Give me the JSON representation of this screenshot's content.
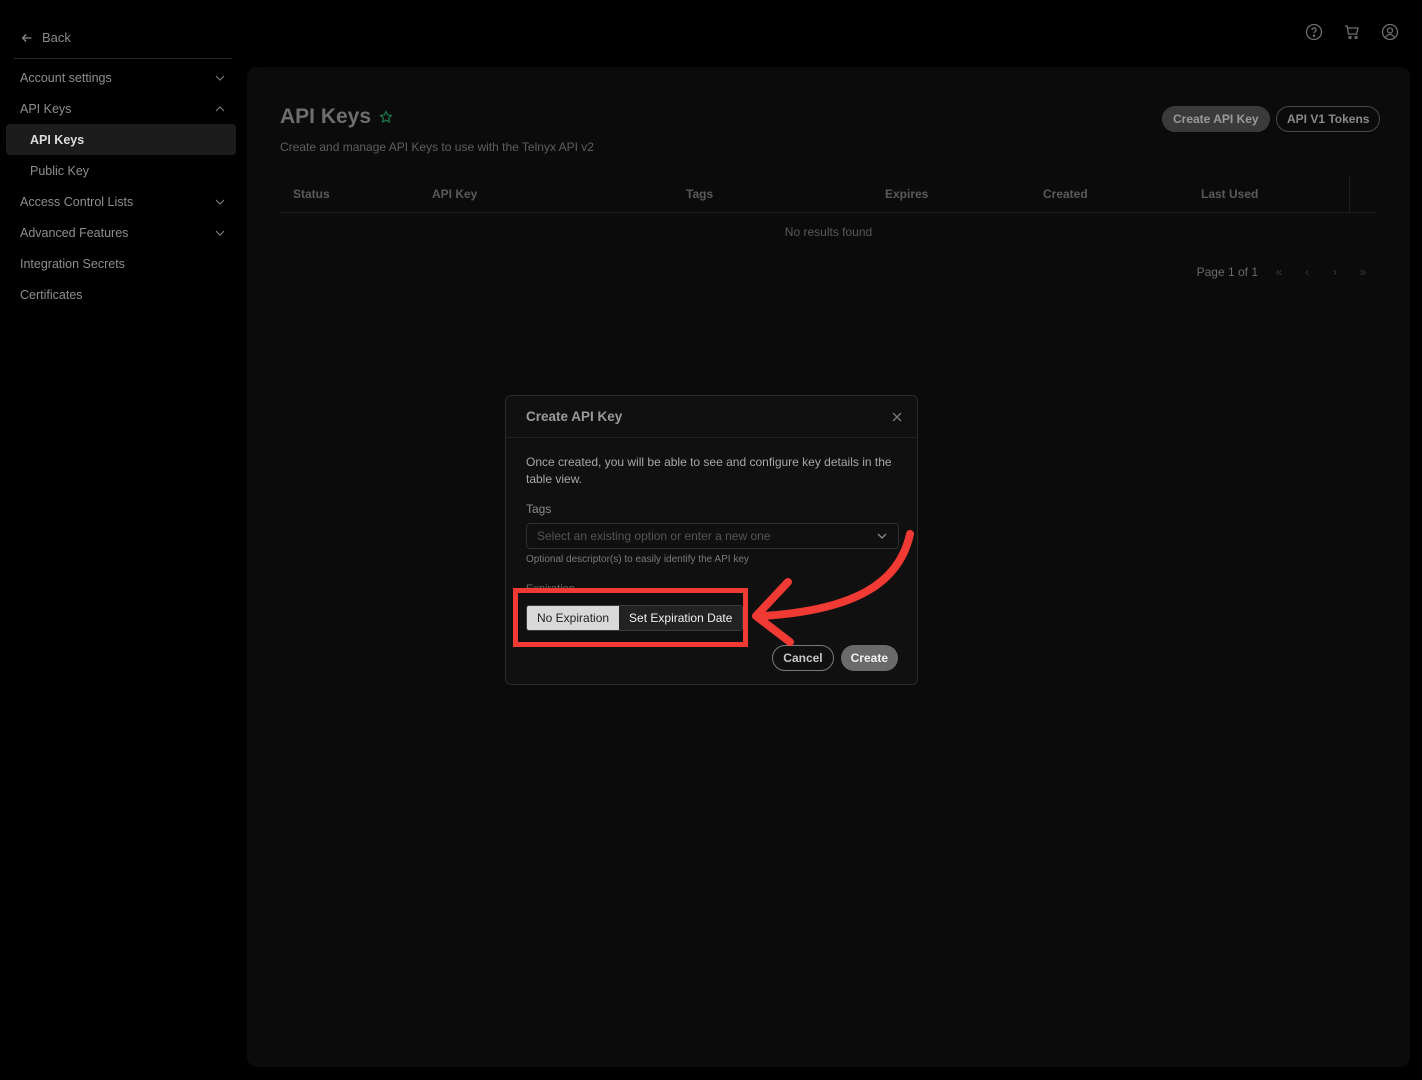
{
  "sidebar": {
    "back_label": "Back",
    "items": [
      {
        "label": "Account settings",
        "chevron": "down"
      },
      {
        "label": "API Keys",
        "chevron": "up"
      },
      {
        "label": "API Keys",
        "active": true
      },
      {
        "label": "Public Key"
      },
      {
        "label": "Access Control Lists",
        "chevron": "down"
      },
      {
        "label": "Advanced Features",
        "chevron": "down"
      },
      {
        "label": "Integration Secrets"
      },
      {
        "label": "Certificates"
      }
    ]
  },
  "top_icons": [
    "help-icon",
    "cart-icon",
    "user-icon"
  ],
  "page": {
    "title": "API Keys",
    "subtitle": "Create and manage API Keys to use with the Telnyx API v2",
    "create_button": "Create API Key",
    "v1_button": "API V1 Tokens"
  },
  "table": {
    "columns": [
      "Status",
      "API Key",
      "Tags",
      "Expires",
      "Created",
      "Last Used"
    ],
    "empty_text": "No results found",
    "pagination": "Page 1 of 1"
  },
  "modal": {
    "title": "Create API Key",
    "description": "Once created, you will be able to see and configure key details in the table view.",
    "tags_label": "Tags",
    "tags_placeholder": "Select an existing option or enter a new one",
    "tags_helper": "Optional descriptor(s) to easily identify the API key",
    "expiration_label": "Expiration",
    "option_no_expiration": "No Expiration",
    "option_set_date": "Set Expiration Date",
    "selected_option": "No Expiration",
    "cancel": "Cancel",
    "create": "Create"
  },
  "colors": {
    "annotation": "#f03a33",
    "star": "#1d7a4c"
  }
}
